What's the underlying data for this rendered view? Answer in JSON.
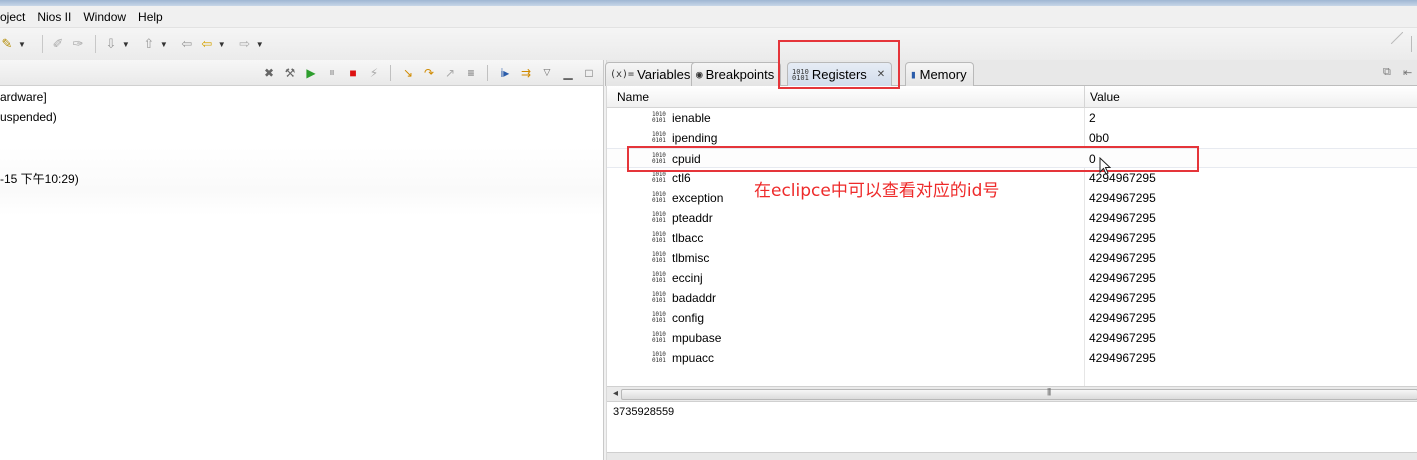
{
  "menubar": {
    "items": [
      {
        "label": "roject"
      },
      {
        "label": "Nios II"
      },
      {
        "label": "Window"
      },
      {
        "label": "Help"
      }
    ]
  },
  "debug_view": {
    "lines": [
      "ardware]",
      "uspended)",
      "-15 下午10:29)"
    ]
  },
  "tabs": [
    {
      "label": "Variables",
      "icon": "variables-icon"
    },
    {
      "label": "Breakpoints",
      "icon": "breakpoints-icon"
    },
    {
      "label": "Registers",
      "icon": "registers-icon",
      "active": true
    },
    {
      "label": "Memory",
      "icon": "memory-icon"
    }
  ],
  "table": {
    "columns": [
      "Name",
      "Value"
    ],
    "rows": [
      {
        "name": "ienable",
        "value": "2"
      },
      {
        "name": "ipending",
        "value": "0b0"
      },
      {
        "name": "cpuid",
        "value": "0"
      },
      {
        "name": "ctl6",
        "value": "4294967295"
      },
      {
        "name": "exception",
        "value": "4294967295"
      },
      {
        "name": "pteaddr",
        "value": "4294967295"
      },
      {
        "name": "tlbacc",
        "value": "4294967295"
      },
      {
        "name": "tlbmisc",
        "value": "4294967295"
      },
      {
        "name": "eccinj",
        "value": "4294967295"
      },
      {
        "name": "badaddr",
        "value": "4294967295"
      },
      {
        "name": "config",
        "value": "4294967295"
      },
      {
        "name": "mpubase",
        "value": "4294967295"
      },
      {
        "name": "mpuacc",
        "value": "4294967295"
      }
    ]
  },
  "detail": {
    "value": "3735928559"
  },
  "annotation": {
    "text": "在eclipce中可以查看对应的id号",
    "color": "#ee2a2a"
  },
  "colors": {
    "annotation_red": "#e5353a",
    "active_tab": "#d2dceb"
  }
}
